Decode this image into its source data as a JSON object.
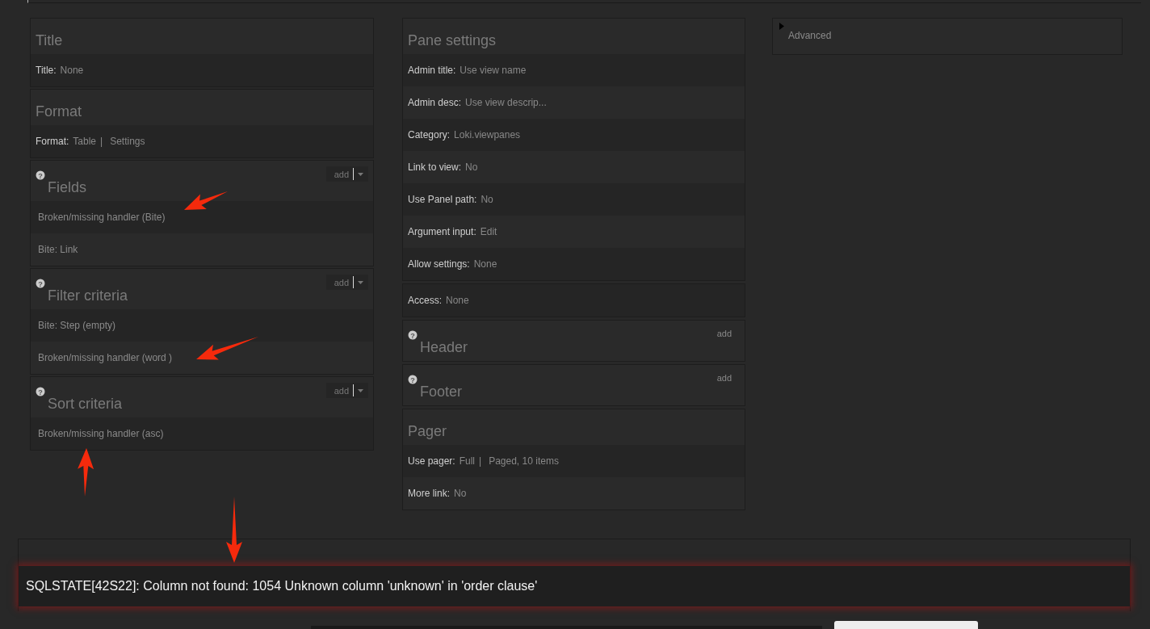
{
  "columns": [
    {
      "sections": [
        {
          "kind": "panel",
          "title": "Title",
          "rows": [
            {
              "kind": "setting",
              "label": "Title:",
              "values": [
                "None"
              ]
            }
          ]
        },
        {
          "kind": "panel",
          "title": "Format",
          "rows": [
            {
              "kind": "setting",
              "label": "Format:",
              "values": [
                "Table",
                "Settings"
              ],
              "separator": "|"
            }
          ]
        },
        {
          "kind": "panel",
          "title": "Fields",
          "help": "?",
          "add_label": "add",
          "add_menu": true,
          "rows": [
            {
              "kind": "handler",
              "text": "Broken/missing handler (Bite)"
            },
            {
              "kind": "handler",
              "text": "Bite: Link"
            }
          ]
        },
        {
          "kind": "panel",
          "title": "Filter criteria",
          "help": "?",
          "add_label": "add",
          "add_menu": true,
          "rows": [
            {
              "kind": "handler",
              "text": "Bite: Step (empty)"
            },
            {
              "kind": "handler",
              "text": "Broken/missing handler (word )"
            }
          ]
        },
        {
          "kind": "panel",
          "title": "Sort criteria",
          "help": "?",
          "add_label": "add",
          "add_menu": true,
          "rows": [
            {
              "kind": "handler",
              "text": "Broken/missing handler (asc)"
            }
          ]
        }
      ]
    },
    {
      "sections": [
        {
          "kind": "panel",
          "title": "Pane settings",
          "rows": [
            {
              "kind": "setting",
              "label": "Admin title:",
              "values": [
                "Use view name"
              ]
            },
            {
              "kind": "setting",
              "label": "Admin desc:",
              "values": [
                "Use view descrip..."
              ]
            },
            {
              "kind": "setting",
              "label": "Category:",
              "values": [
                "Loki.viewpanes"
              ]
            },
            {
              "kind": "setting",
              "label": "Link to view:",
              "values": [
                "No"
              ]
            },
            {
              "kind": "setting",
              "label": "Use Panel path:",
              "values": [
                "No"
              ]
            },
            {
              "kind": "setting",
              "label": "Argument input:",
              "values": [
                "Edit"
              ]
            },
            {
              "kind": "setting",
              "label": "Allow settings:",
              "values": [
                "None"
              ]
            }
          ]
        },
        {
          "kind": "panel",
          "rows": [
            {
              "kind": "setting",
              "label": "Access:",
              "values": [
                "None"
              ]
            }
          ]
        },
        {
          "kind": "panel",
          "title": "Header",
          "help": "?",
          "add_label": "add",
          "add_menu": false
        },
        {
          "kind": "panel",
          "title": "Footer",
          "help": "?",
          "add_label": "add",
          "add_menu": false
        },
        {
          "kind": "panel",
          "title": "Pager",
          "rows": [
            {
              "kind": "setting",
              "label": "Use pager:",
              "values": [
                "Full",
                "Paged, 10 items"
              ],
              "separator": "|"
            },
            {
              "kind": "setting",
              "label": "More link:",
              "values": [
                "No"
              ]
            }
          ]
        }
      ]
    },
    {
      "sections": [
        {
          "kind": "collapsible",
          "expanded": false,
          "title": "Advanced"
        }
      ]
    }
  ],
  "error": {
    "message": "SQLSTATE[42S22]: Column not found: 1054 Unknown column 'unknown' in 'order clause'"
  }
}
